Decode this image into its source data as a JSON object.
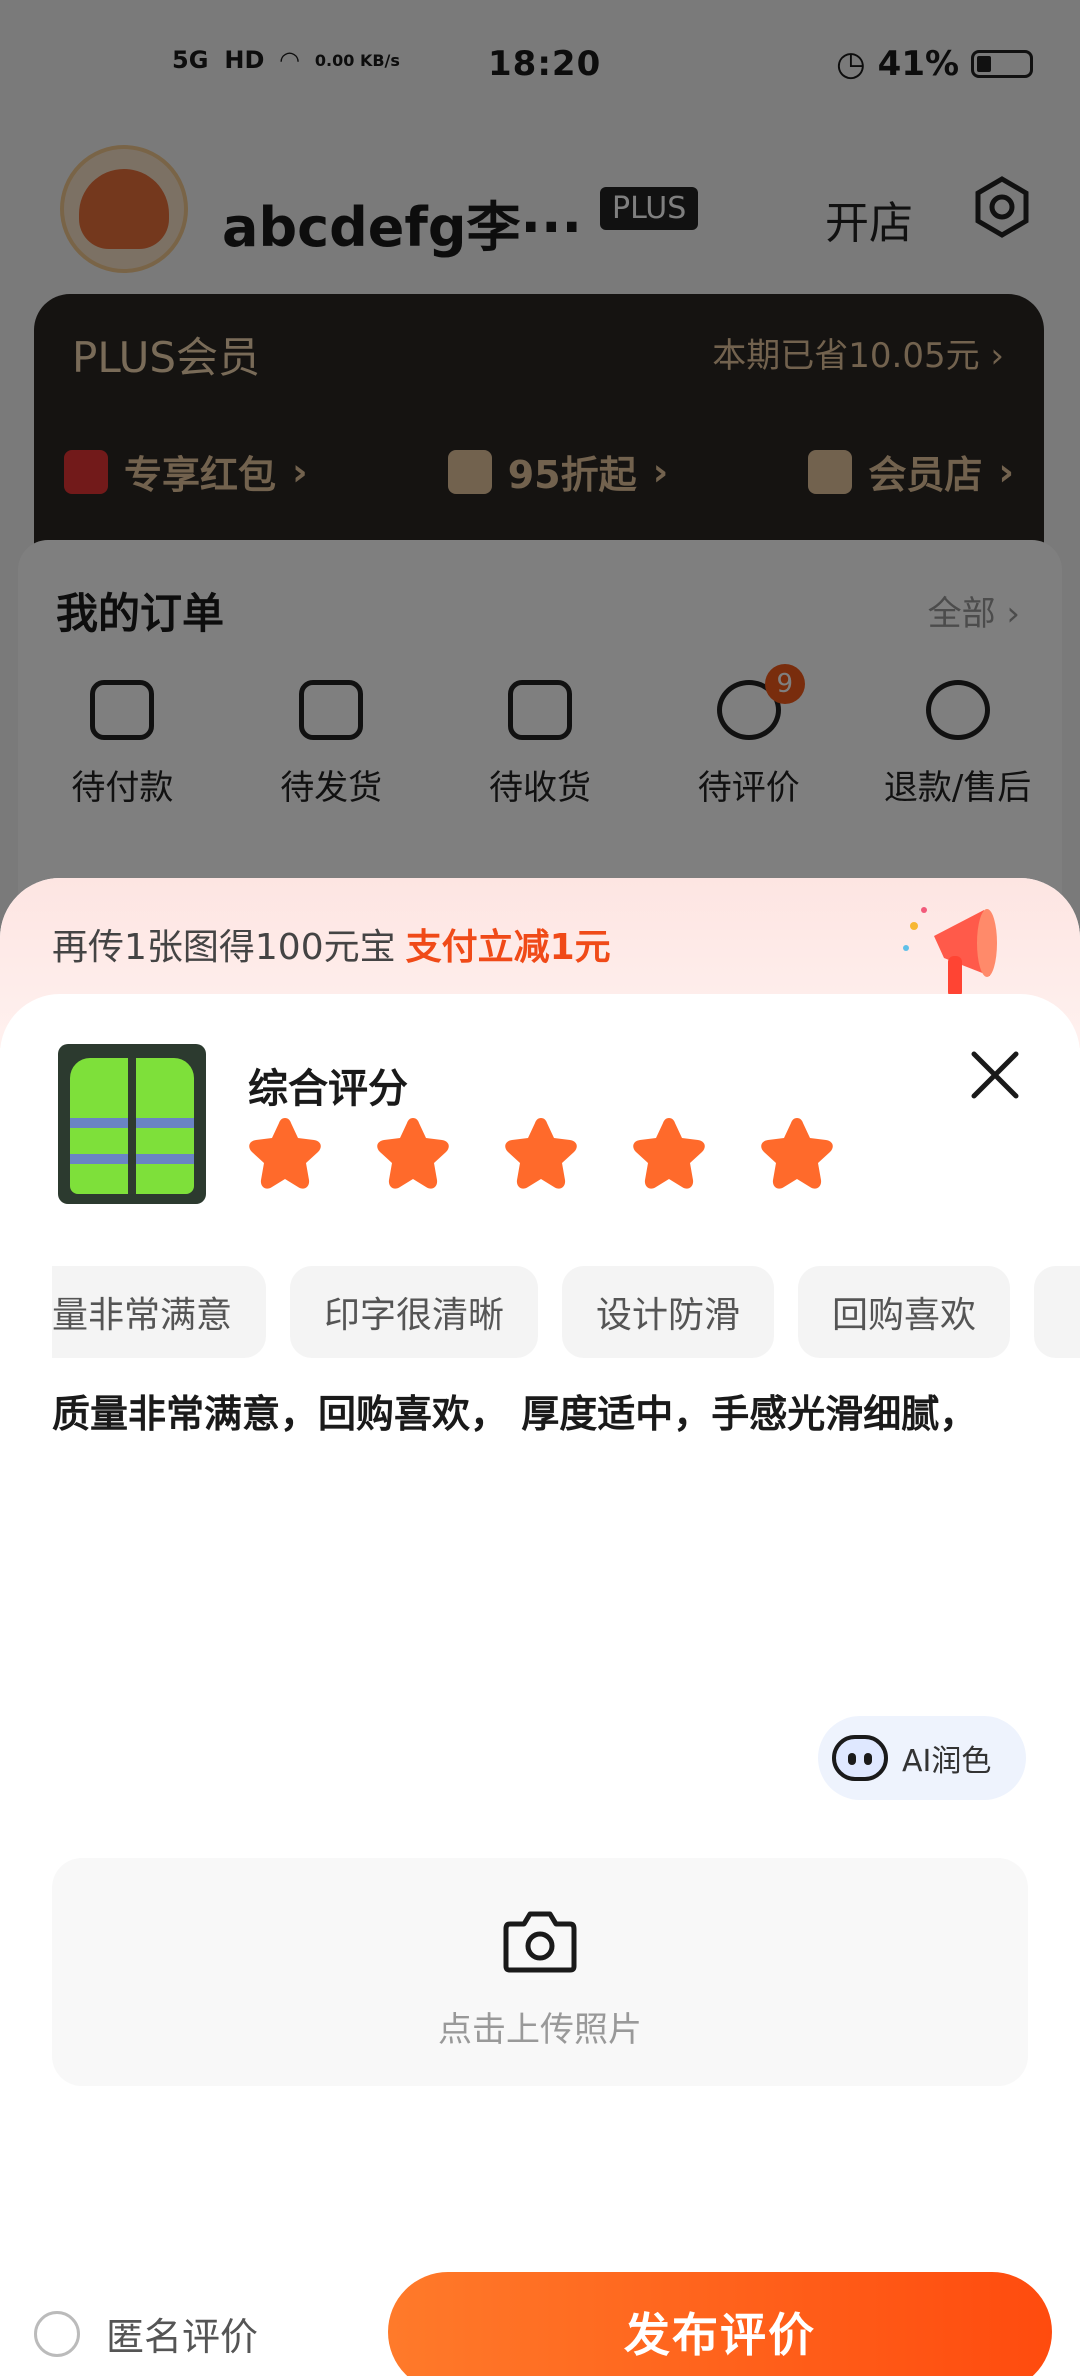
{
  "status_bar": {
    "time": "18:20",
    "network": "5G",
    "hd": "HD",
    "speed": "0.00 KB/s",
    "battery": "41%"
  },
  "profile": {
    "username": "abcdefg李···",
    "badge": "PLUS",
    "open_shop": "开店"
  },
  "plus_card": {
    "title": "PLUS会员",
    "saved": "本期已省10.05元",
    "perks": [
      "专享红包",
      "95折起",
      "会员店"
    ]
  },
  "orders": {
    "title": "我的订单",
    "all": "全部",
    "items": [
      {
        "label": "待付款"
      },
      {
        "label": "待发货"
      },
      {
        "label": "待收货"
      },
      {
        "label": "待评价",
        "badge": "9"
      },
      {
        "label": "退款/售后"
      }
    ]
  },
  "promo": {
    "text": "再传1张图得100元宝",
    "highlight": "支付立减1元"
  },
  "review": {
    "title": "综合评分",
    "rating": 5,
    "tags": [
      "量非常满意",
      "印字很清晰",
      "设计防滑",
      "回购喜欢",
      ""
    ],
    "text": "质量非常满意，回购喜欢， 厚度适中，手感光滑细腻，",
    "ai_button": "AI润色",
    "upload_label": "点击上传照片",
    "anonymous_label": "匿名评价",
    "publish_label": "发布评价"
  },
  "colors": {
    "accent": "#FF5A14",
    "star": "#FF6A2B",
    "badge": "#F25A1B"
  }
}
